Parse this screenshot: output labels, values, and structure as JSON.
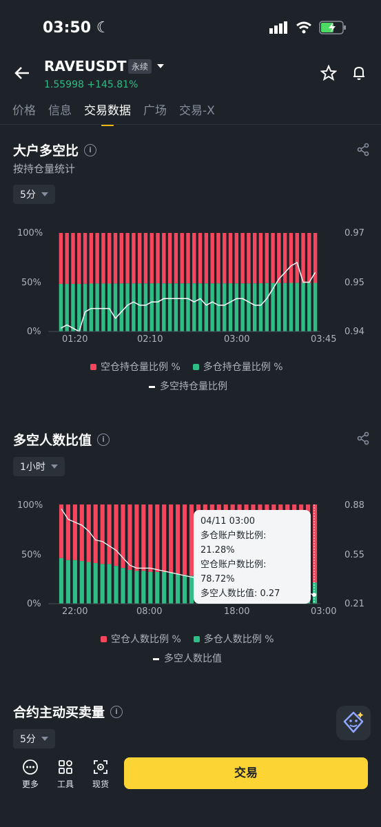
{
  "status": {
    "time": "03:50"
  },
  "header": {
    "symbol": "RAVEUSDT",
    "badge": "永续",
    "price": "1.55998",
    "change": "+145.81%"
  },
  "tabs": [
    "价格",
    "信息",
    "交易数据",
    "广场",
    "交易-X"
  ],
  "section1": {
    "title": "大户多空比",
    "subtitle": "按持仓量统计",
    "interval": "5分",
    "left_ticks": [
      "100%",
      "50%",
      "0%"
    ],
    "right_ticks": [
      "0.97",
      "0.95",
      "0.94"
    ],
    "x_ticks": [
      "01:20",
      "02:10",
      "03:00",
      "03:45"
    ],
    "legend": {
      "short": "空仓持仓量比例 %",
      "long": "多仓持仓量比例 %",
      "ratio": "多空持仓量比例"
    }
  },
  "section2": {
    "title": "多空人数比值",
    "interval": "1小时",
    "left_ticks": [
      "100%",
      "50%",
      "0%"
    ],
    "right_ticks": [
      "0.88",
      "0.55",
      "0.21"
    ],
    "x_ticks": [
      "22:00",
      "08:00",
      "18:00",
      "03:00"
    ],
    "legend": {
      "short": "空仓人数比例 %",
      "long": "多仓人数比例 %",
      "ratio": "多空人数比值"
    },
    "tooltip": {
      "date": "04/11 03:00",
      "long_label": "多仓账户数比例:",
      "long_value": "21.28%",
      "short_label": "空仓账户数比例:",
      "short_value": "78.72%",
      "ratio_label": "多空人数比值: 0.27"
    }
  },
  "section3": {
    "title": "合约主动买卖量",
    "interval": "5分"
  },
  "bottom": {
    "more": "更多",
    "tools": "工具",
    "spot": "现货",
    "trade": "交易"
  },
  "colors": {
    "red": "#f6465d",
    "green": "#2ebd85",
    "accent": "#fcd535"
  },
  "chart_data": [
    {
      "type": "bar",
      "title": "大户多空比",
      "series": [
        {
          "name": "多仓持仓量比例 %",
          "values": [
            48.3,
            48.3,
            48.3,
            48.3,
            48.4,
            48.6,
            48.7,
            48.7,
            48.6,
            48.7,
            48.8,
            48.8,
            48.8,
            48.8,
            48.8,
            48.8,
            48.9,
            48.8,
            48.8,
            48.8,
            48.8,
            48.8,
            48.8,
            48.8,
            48.8,
            48.8,
            48.8,
            48.8,
            48.9,
            48.8,
            48.8,
            48.8,
            48.8,
            48.9,
            49.1,
            49.2,
            49.3,
            49.2,
            49.3,
            49.4,
            49.3,
            49.3,
            49.3
          ]
        },
        {
          "name": "空仓持仓量比例 %",
          "values": [
            51.7,
            51.7,
            51.7,
            51.7,
            51.6,
            51.4,
            51.3,
            51.3,
            51.4,
            51.3,
            51.2,
            51.2,
            51.2,
            51.2,
            51.2,
            51.2,
            51.1,
            51.2,
            51.2,
            51.2,
            51.2,
            51.2,
            51.2,
            51.2,
            51.2,
            51.2,
            51.2,
            51.2,
            51.1,
            51.2,
            51.2,
            51.2,
            51.2,
            51.1,
            50.9,
            50.8,
            50.7,
            50.8,
            50.7,
            50.6,
            50.7,
            50.7,
            50.7
          ]
        },
        {
          "name": "多空持仓量比例",
          "values": [
            0.941,
            0.942,
            0.941,
            0.94,
            0.946,
            0.947,
            0.947,
            0.947,
            0.947,
            0.944,
            0.946,
            0.948,
            0.949,
            0.948,
            0.948,
            0.949,
            0.949,
            0.95,
            0.95,
            0.95,
            0.95,
            0.95,
            0.949,
            0.95,
            0.948,
            0.949,
            0.948,
            0.948,
            0.949,
            0.95,
            0.95,
            0.949,
            0.948,
            0.948,
            0.95,
            0.953,
            0.956,
            0.958,
            0.96,
            0.961,
            0.955,
            0.955,
            0.958
          ]
        }
      ],
      "ylim_left": [
        0,
        100
      ],
      "ylim_right": [
        0.94,
        0.97
      ]
    },
    {
      "type": "bar",
      "title": "多空人数比值",
      "series": [
        {
          "name": "多仓人数比例 %",
          "values": [
            46,
            44,
            44,
            43,
            42,
            41,
            40,
            40,
            38,
            36,
            34,
            33,
            33,
            32,
            32,
            32,
            31,
            30,
            29,
            28,
            28,
            27,
            27,
            26,
            26,
            25,
            25,
            24,
            24,
            24,
            23,
            23,
            23,
            23,
            22,
            22,
            22,
            21.28
          ]
        },
        {
          "name": "空仓人数比例 %",
          "values": [
            54,
            56,
            56,
            57,
            58,
            59,
            60,
            60,
            62,
            64,
            66,
            67,
            67,
            68,
            68,
            68,
            69,
            70,
            71,
            72,
            72,
            73,
            73,
            74,
            74,
            75,
            75,
            76,
            76,
            76,
            77,
            77,
            77,
            77,
            78,
            78,
            78,
            78.72
          ]
        },
        {
          "name": "多空人数比值",
          "values": [
            0.85,
            0.78,
            0.76,
            0.74,
            0.7,
            0.64,
            0.63,
            0.6,
            0.57,
            0.52,
            0.47,
            0.45,
            0.45,
            0.45,
            0.44,
            0.43,
            0.42,
            0.41,
            0.4,
            0.39,
            0.38,
            0.36,
            0.35,
            0.34,
            0.33,
            0.32,
            0.32,
            0.31,
            0.3,
            0.3,
            0.29,
            0.29,
            0.29,
            0.29,
            0.28,
            0.28,
            0.28,
            0.27
          ]
        }
      ],
      "ylim_left": [
        0,
        100
      ],
      "ylim_right": [
        0.21,
        0.88
      ]
    }
  ]
}
